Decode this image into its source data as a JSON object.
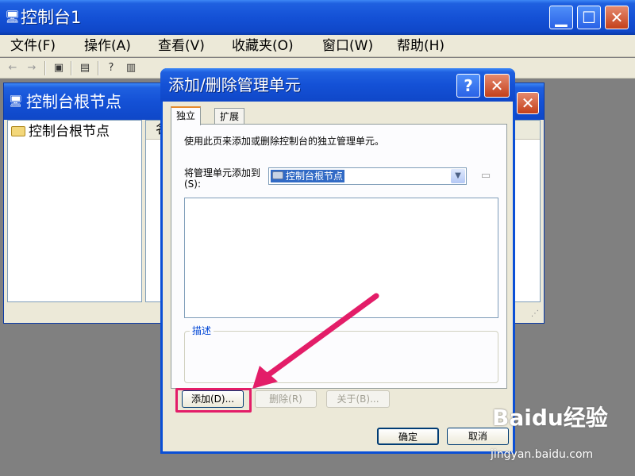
{
  "window": {
    "title": "控制台1"
  },
  "menu": [
    "文件(F)",
    "操作(A)",
    "查看(V)",
    "收藏夹(O)",
    "窗口(W)",
    "帮助(H)"
  ],
  "toolbar_icons": [
    "back-arrow-icon",
    "forward-arrow-icon",
    "show-hide-tree-icon",
    "export-list-icon",
    "help-icon",
    "properties-icon"
  ],
  "inner_window": {
    "title": "控制台根节点",
    "tree_root": "控制台根节点",
    "list_header": "名"
  },
  "dialog": {
    "title": "添加/删除管理单元",
    "tabs": [
      "独立",
      "扩展"
    ],
    "description": "使用此页来添加或删除控制台的独立管理单元。",
    "add_to_label": "将管理单元添加到(S):",
    "add_to_value": "控制台根节点",
    "group_label": "描述",
    "buttons": {
      "add": "添加(D)...",
      "remove": "删除(R)",
      "about": "关于(B)..."
    },
    "ok": "确定",
    "cancel": "取消"
  },
  "watermark": {
    "brand": "Baidu经验",
    "url": "jingyan.baidu.com"
  },
  "colors": {
    "xp_blue": "#1451d6",
    "dialog_bg": "#ece9d8",
    "highlight": "#e31d68"
  }
}
